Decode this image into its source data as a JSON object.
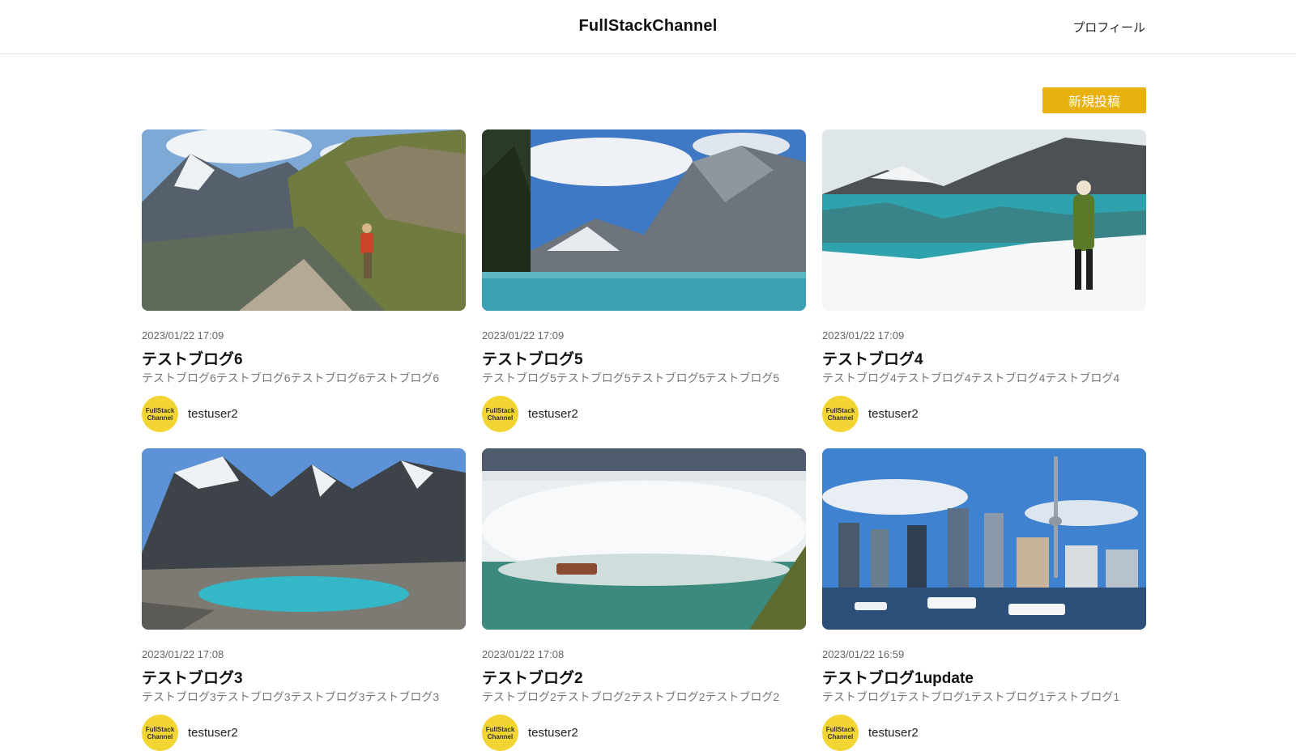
{
  "header": {
    "title": "FullStackChannel",
    "profile_label": "プロフィール"
  },
  "toolbar": {
    "new_post_label": "新規投稿"
  },
  "avatar_text": {
    "line1": "FullStack",
    "line2": "Channel"
  },
  "posts": [
    {
      "date": "2023/01/22 17:09",
      "title": "テストブログ6",
      "excerpt": "テストブログ6テストブログ6テストブログ6テストブログ6",
      "author": "testuser2",
      "image": "mountain-trail-hiker"
    },
    {
      "date": "2023/01/22 17:09",
      "title": "テストブログ5",
      "excerpt": "テストブログ5テストブログ5テストブログ5テストブログ5",
      "author": "testuser2",
      "image": "mountain-lake"
    },
    {
      "date": "2023/01/22 17:09",
      "title": "テストブログ4",
      "excerpt": "テストブログ4テストブログ4テストブログ4テストブログ4",
      "author": "testuser2",
      "image": "winter-lake-hiker"
    },
    {
      "date": "2023/01/22 17:08",
      "title": "テストブログ3",
      "excerpt": "テストブログ3テストブログ3テストブログ3テストブログ3",
      "author": "testuser2",
      "image": "alpine-lake"
    },
    {
      "date": "2023/01/22 17:08",
      "title": "テストブログ2",
      "excerpt": "テストブログ2テストブログ2テストブログ2テストブログ2",
      "author": "testuser2",
      "image": "waterfall-boat"
    },
    {
      "date": "2023/01/22 16:59",
      "title": "テストブログ1update",
      "excerpt": "テストブログ1テストブログ1テストブログ1テストブログ1",
      "author": "testuser2",
      "image": "city-harbor-skyline"
    }
  ],
  "colors": {
    "accent": "#e8b10e",
    "avatar": "#f2d533"
  }
}
